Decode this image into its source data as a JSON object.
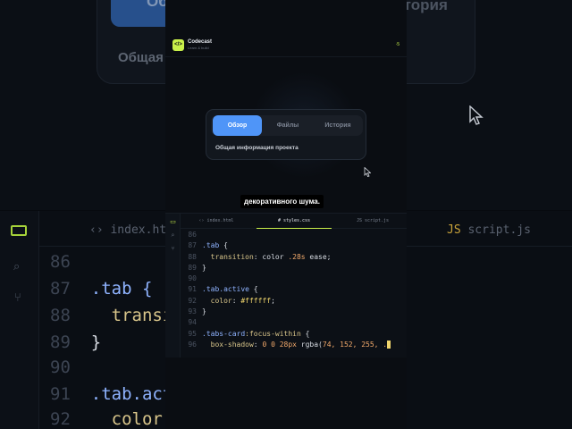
{
  "app": {
    "brand": "Codecast",
    "tagline": "Learn & build",
    "badge": "·5"
  },
  "tabs_card": {
    "tabs": [
      {
        "label": "Обзор",
        "active": true
      },
      {
        "label": "Файлы",
        "active": false
      },
      {
        "label": "История",
        "active": false
      }
    ],
    "subtitle": "Общая информация проекта"
  },
  "caption": "декоративного шума.",
  "editor": {
    "tabs": [
      {
        "label": "‹› index.html",
        "active": false
      },
      {
        "label": "# styles.css",
        "active": true
      },
      {
        "label": "JS script.js",
        "active": false
      }
    ],
    "lines": [
      {
        "n": "86",
        "text": ""
      },
      {
        "n": "87",
        "text": ".tab {"
      },
      {
        "n": "88",
        "text": "  transition: color .28s ease;"
      },
      {
        "n": "89",
        "text": "}"
      },
      {
        "n": "90",
        "text": ""
      },
      {
        "n": "91",
        "text": ".tab.active {"
      },
      {
        "n": "92",
        "text": "  color: #ffffff;"
      },
      {
        "n": "93",
        "text": "}"
      },
      {
        "n": "94",
        "text": ""
      },
      {
        "n": "95",
        "text": ".tabs-card:focus-within {"
      },
      {
        "n": "96",
        "text": "  box-shadow: 0 0 28px rgba(74, 152, 255, ."
      }
    ]
  },
  "background": {
    "top_tab_active": "Обзор",
    "top_tab_other": "История",
    "top_subtitle": "Общая",
    "editor_tabs": [
      "index.html",
      "script.js"
    ],
    "code_lines": [
      {
        "n": "86",
        "text": ""
      },
      {
        "n": "87",
        "text": ".tab {"
      },
      {
        "n": "88",
        "text": "  transi"
      },
      {
        "n": "89",
        "text": "}"
      },
      {
        "n": "90",
        "text": ""
      },
      {
        "n": "91",
        "text": ".tab.act"
      },
      {
        "n": "92",
        "text": "  color:"
      }
    ]
  },
  "colors": {
    "accent": "#c9f04a",
    "tab_active": "#4f95f8",
    "background": "#0a0d12"
  }
}
